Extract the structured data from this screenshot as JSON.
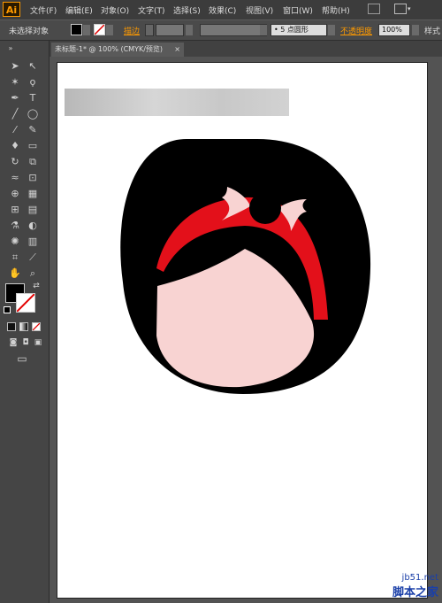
{
  "menubar": {
    "logo": "Ai",
    "items": [
      "文件(F)",
      "编辑(E)",
      "对象(O)",
      "文字(T)",
      "选择(S)",
      "效果(C)",
      "视图(V)",
      "窗口(W)",
      "帮助(H)"
    ]
  },
  "control_bar": {
    "selection_status": "未选择对象",
    "stroke_label": "描边",
    "brush_value": "5 点圆形",
    "opacity_label": "不透明度",
    "opacity_value": "100%",
    "style_label": "样式"
  },
  "document_tab": {
    "title": "未标题-1* @ 100% (CMYK/预览)",
    "close": "×"
  },
  "watermark": {
    "url": "jb51.net",
    "name": "脚本之家"
  },
  "colors": {
    "hair": "#000000",
    "headband": "#e3101a",
    "face": "#f8d3d2",
    "accent": "#ff9a00"
  }
}
